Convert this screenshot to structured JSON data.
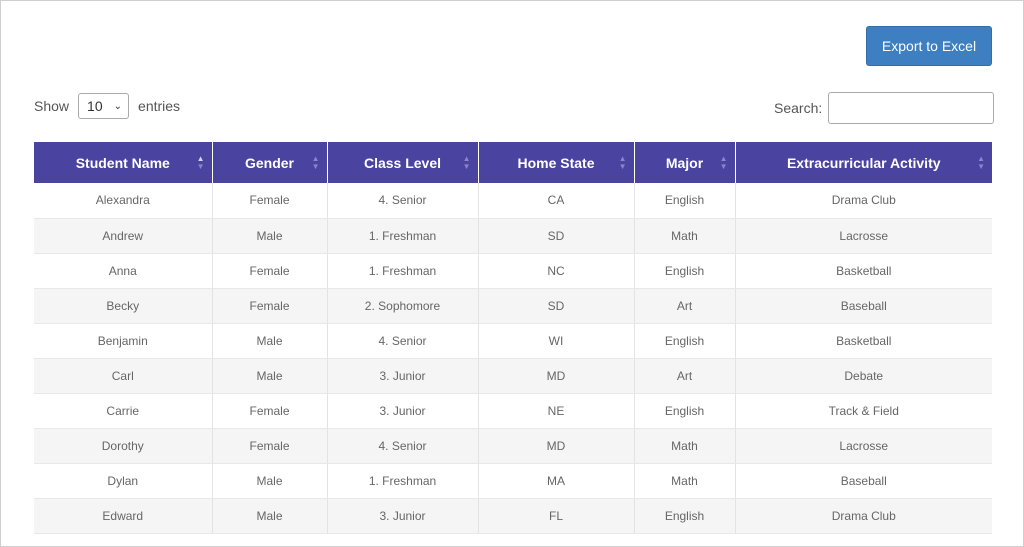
{
  "toolbar": {
    "export_label": "Export to Excel"
  },
  "length": {
    "show_label": "Show",
    "value": "10",
    "entries_label": "entries"
  },
  "search": {
    "label": "Search:",
    "value": ""
  },
  "colors": {
    "header_bg": "#4a43a0",
    "button_bg": "#3d7fc1",
    "row_alt": "#f5f5f5"
  },
  "table": {
    "columns": [
      "Student Name",
      "Gender",
      "Class Level",
      "Home State",
      "Major",
      "Extracurricular Activity"
    ],
    "sorted_column": "Student Name",
    "sort_direction": "ascending",
    "rows": [
      [
        "Alexandra",
        "Female",
        "4. Senior",
        "CA",
        "English",
        "Drama Club"
      ],
      [
        "Andrew",
        "Male",
        "1. Freshman",
        "SD",
        "Math",
        "Lacrosse"
      ],
      [
        "Anna",
        "Female",
        "1. Freshman",
        "NC",
        "English",
        "Basketball"
      ],
      [
        "Becky",
        "Female",
        "2. Sophomore",
        "SD",
        "Art",
        "Baseball"
      ],
      [
        "Benjamin",
        "Male",
        "4. Senior",
        "WI",
        "English",
        "Basketball"
      ],
      [
        "Carl",
        "Male",
        "3. Junior",
        "MD",
        "Art",
        "Debate"
      ],
      [
        "Carrie",
        "Female",
        "3. Junior",
        "NE",
        "English",
        "Track & Field"
      ],
      [
        "Dorothy",
        "Female",
        "4. Senior",
        "MD",
        "Math",
        "Lacrosse"
      ],
      [
        "Dylan",
        "Male",
        "1. Freshman",
        "MA",
        "Math",
        "Baseball"
      ],
      [
        "Edward",
        "Male",
        "3. Junior",
        "FL",
        "English",
        "Drama Club"
      ]
    ]
  }
}
